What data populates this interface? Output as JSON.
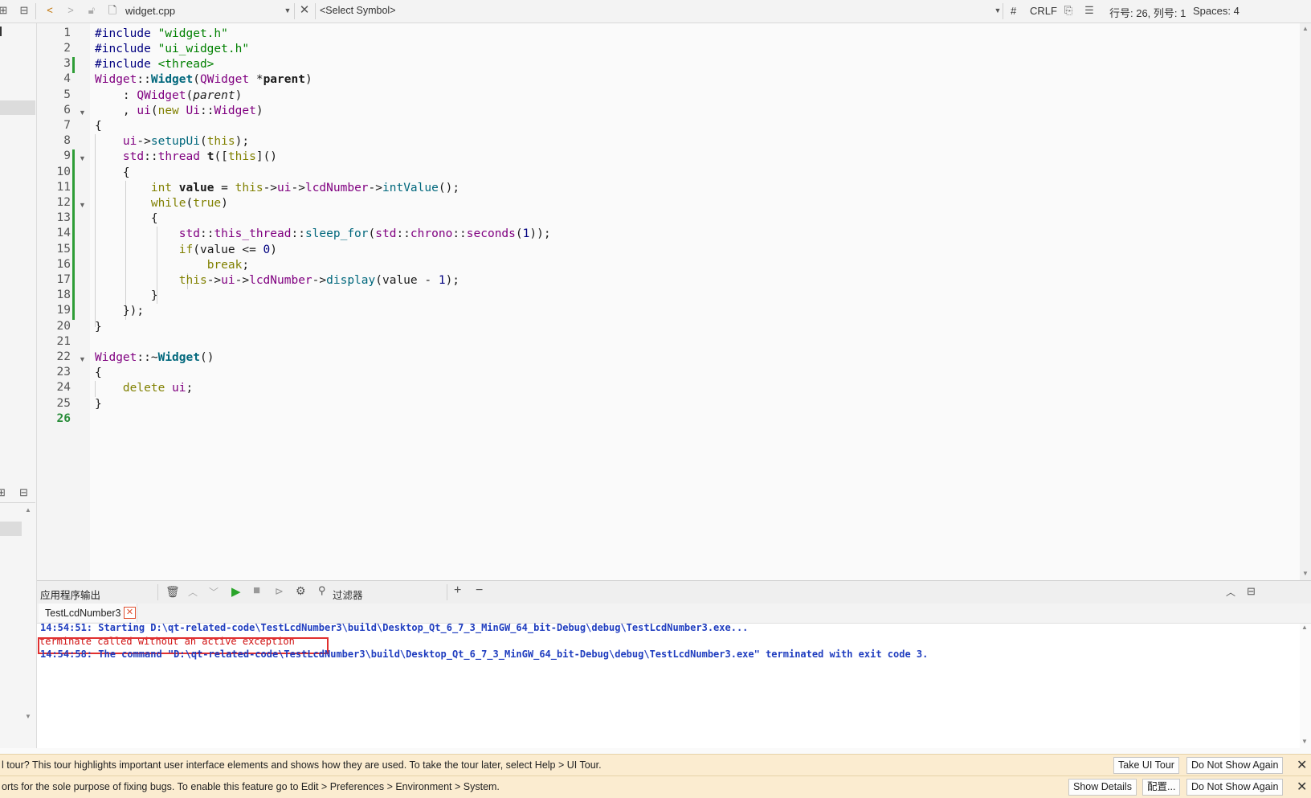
{
  "toolbar": {
    "file_name": "widget.cpp",
    "symbol_placeholder": "<Select Symbol>",
    "hash": "#",
    "line_ending": "CRLF",
    "position": "行号: 26, 列号: 1",
    "indent": "Spaces: 4"
  },
  "editor": {
    "line_numbers": [
      "1",
      "2",
      "3",
      "4",
      "5",
      "6",
      "7",
      "8",
      "9",
      "10",
      "11",
      "12",
      "13",
      "14",
      "15",
      "16",
      "17",
      "18",
      "19",
      "20",
      "21",
      "22",
      "23",
      "24",
      "25",
      "26"
    ],
    "current_line": "26"
  },
  "output": {
    "title": "应用程序输出",
    "filter_label": "过滤器",
    "tab_label": "TestLcdNumber3",
    "lines": [
      "14:54:51: Starting D:\\qt-related-code\\TestLcdNumber3\\build\\Desktop_Qt_6_7_3_MinGW_64_bit-Debug\\debug\\TestLcdNumber3.exe...",
      "terminate called without an active exception",
      "14:54:58: The command \"D:\\qt-related-code\\TestLcdNumber3\\build\\Desktop_Qt_6_7_3_MinGW_64_bit-Debug\\debug\\TestLcdNumber3.exe\" terminated with exit code 3."
    ]
  },
  "infobar1": {
    "text": "l tour? This tour highlights important user interface elements and shows how they are used. To take the tour later, select Help > UI Tour.",
    "take_tour": "Take UI Tour",
    "dont_show": "Do Not Show Again"
  },
  "infobar2": {
    "text": "orts for the sole purpose of fixing bugs. To enable this feature go to Edit > Preferences > Environment > System.",
    "show_details": "Show Details",
    "configure": "配置...",
    "dont_show": "Do Not Show Again"
  }
}
